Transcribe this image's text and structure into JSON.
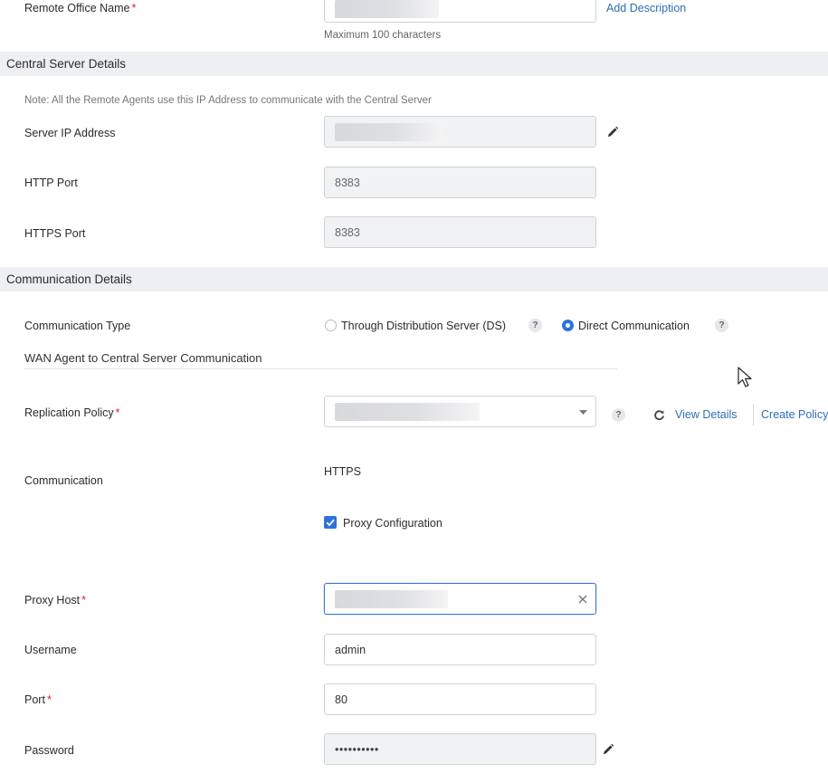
{
  "remote_office": {
    "label": "Remote Office Name",
    "required_mark": "*",
    "add_description_link": "Add Description",
    "hint": "Maximum 100 characters"
  },
  "central_server": {
    "section_title": "Central Server Details",
    "note": "Note: All the Remote Agents use this IP Address to communicate with the Central Server",
    "server_ip_label": "Server IP Address",
    "http_port_label": "HTTP Port",
    "http_port_value": "8383",
    "https_port_label": "HTTPS Port",
    "https_port_value": "8383"
  },
  "communication": {
    "section_title": "Communication Details",
    "type_label": "Communication Type",
    "option_ds": "Through Distribution Server (DS)",
    "option_direct": "Direct Communication",
    "selected_option": "Direct Communication",
    "help_glyph": "?",
    "wan_heading": "WAN Agent to Central Server Communication",
    "replication_label": "Replication Policy",
    "replication_required_mark": "*",
    "view_details_link": "View Details",
    "create_policy_link": "Create Policy",
    "communication_label": "Communication",
    "communication_value": "HTTPS",
    "proxy_checkbox_label": "Proxy Configuration",
    "proxy_checked": true,
    "proxy_host_label": "Proxy Host",
    "proxy_host_required_mark": "*",
    "username_label": "Username",
    "username_value": "admin",
    "port_label": "Port",
    "port_required_mark": "*",
    "port_value": "80",
    "password_label": "Password",
    "password_value": "••••••••••"
  },
  "colors": {
    "accent": "#2f72dd",
    "link": "#2f6db7",
    "required": "#d9232d",
    "section_bg": "#eeeff3"
  },
  "icons": [
    "pencil-icon",
    "help-icon",
    "refresh-icon",
    "dropdown-caret-icon",
    "clear-icon",
    "checkbox-check-icon",
    "mouse-cursor-icon"
  ]
}
